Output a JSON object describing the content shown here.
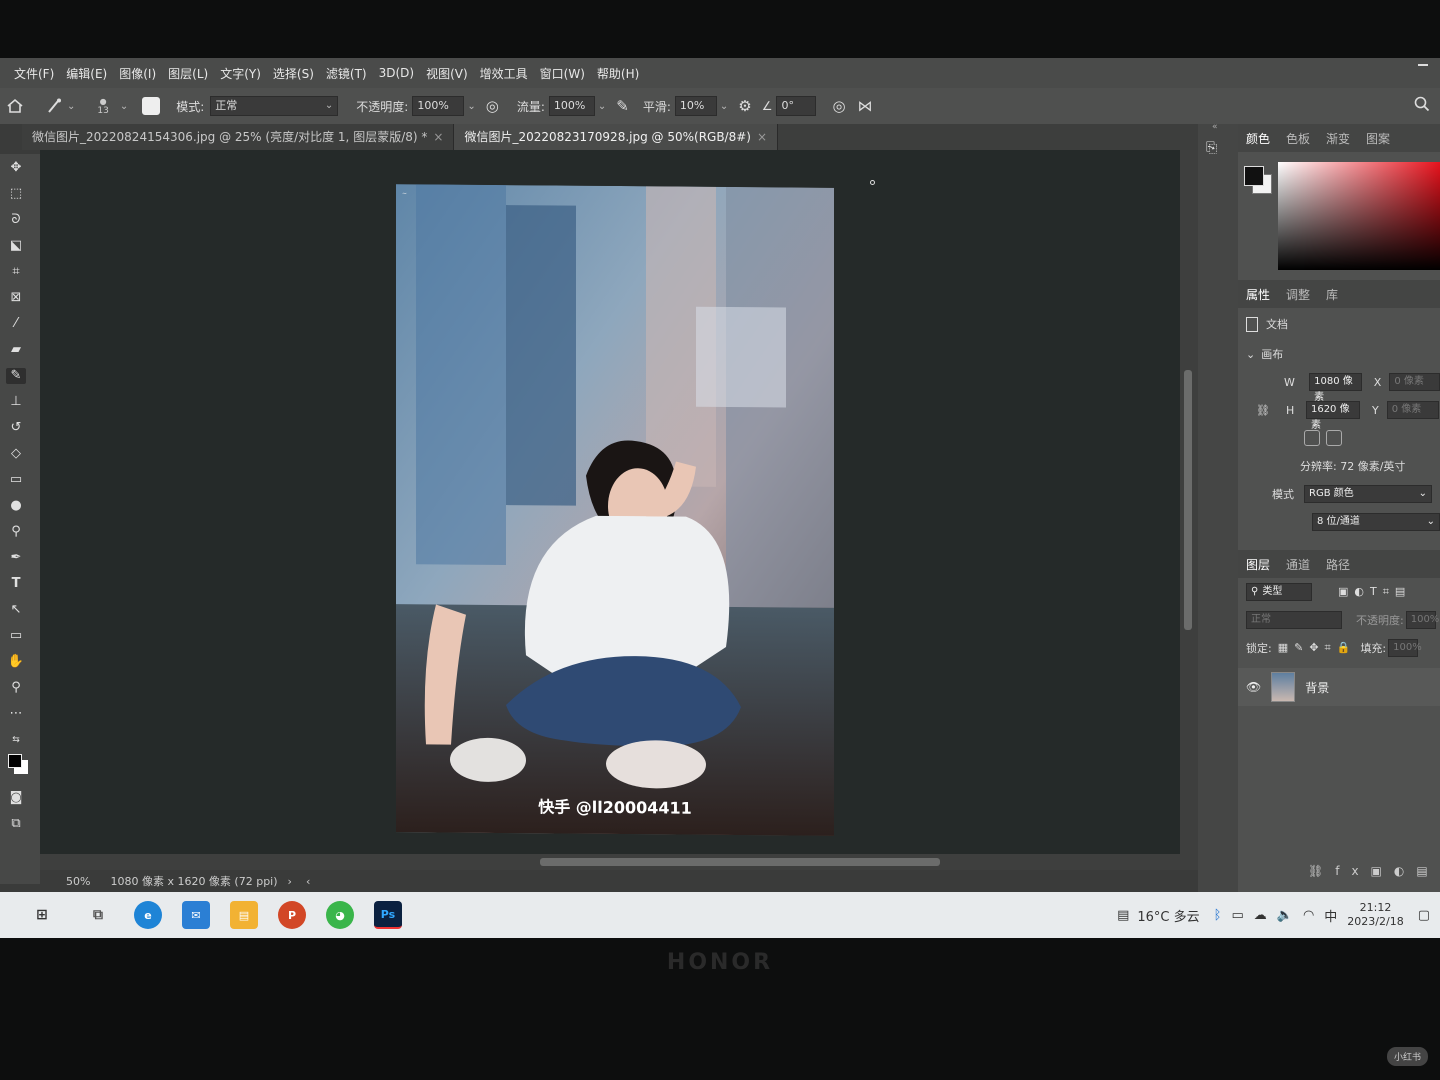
{
  "menubar": {
    "items": [
      "文件(F)",
      "编辑(E)",
      "图像(I)",
      "图层(L)",
      "文字(Y)",
      "选择(S)",
      "滤镜(T)",
      "3D(D)",
      "视图(V)",
      "增效工具",
      "窗口(W)",
      "帮助(H)"
    ]
  },
  "options": {
    "brush_size": "13",
    "mode_label": "模式:",
    "mode_value": "正常",
    "opacity_label": "不透明度:",
    "opacity_value": "100%",
    "flow_label": "流量:",
    "flow_value": "100%",
    "smooth_label": "平滑:",
    "smooth_value": "10%",
    "angle_value": "0°"
  },
  "tabs": [
    {
      "label": "微信图片_20220824154306.jpg @ 25% (亮度/对比度 1, 图层蒙版/8) *"
    },
    {
      "label": "微信图片_20220823170928.jpg @ 50%(RGB/8#)"
    }
  ],
  "canvas": {
    "caption": "快手 @ll20004411"
  },
  "status": {
    "zoom": "50%",
    "doc_info": "1080 像素 x 1620 像素 (72 ppi)"
  },
  "color_panel": {
    "tabs": [
      "颜色",
      "色板",
      "渐变",
      "图案"
    ]
  },
  "properties_panel": {
    "tabs": [
      "属性",
      "调整",
      "库"
    ],
    "doc_label": "文档",
    "canvas_label": "画布",
    "w_label": "W",
    "w_value": "1080 像素",
    "h_label": "H",
    "h_value": "1620 像素",
    "x_label": "X",
    "x_value": "0 像素",
    "y_label": "Y",
    "y_value": "0 像素",
    "resolution": "分辨率: 72 像素/英寸",
    "mode_label": "模式",
    "mode_value": "RGB 颜色",
    "depth_value": "8 位/通道"
  },
  "layers_panel": {
    "tabs": [
      "图层",
      "通道",
      "路径"
    ],
    "filter_label": "类型",
    "blend_value": "正常",
    "opacity_label": "不透明度:",
    "opacity_value": "100%",
    "lock_label": "锁定:",
    "fill_label": "填充:",
    "fill_value": "100%",
    "layer_name": "背景"
  },
  "taskbar": {
    "weather": "16°C 多云",
    "ime": "中",
    "time": "21:12",
    "date": "2023/2/18",
    "ps_label": "Ps"
  },
  "device": {
    "brand": "HONOR"
  },
  "overlay": {
    "watermark": "小红书"
  }
}
